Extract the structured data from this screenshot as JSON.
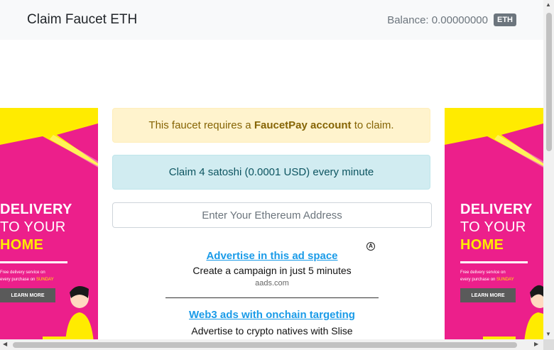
{
  "navbar": {
    "brand": "Claim Faucet ETH",
    "balance_label": "Balance: 0.00000000",
    "currency_badge": "ETH"
  },
  "alerts": {
    "faucetpay_prefix": "This faucet requires a",
    "faucetpay_strong": "FaucetPay account",
    "faucetpay_suffix": "to claim.",
    "claim_info": "Claim 4 satoshi (0.0001 USD) every minute"
  },
  "address_input": {
    "placeholder": "Enter Your Ethereum Address",
    "value": ""
  },
  "side_ads": {
    "line1": "DELIVERY",
    "line2": "TO YOUR",
    "line3": "HOME",
    "small1": "Free delivery service on",
    "small2_prefix": "every purchase on",
    "small2_day": "SUNDAY",
    "button": "LEARN MORE"
  },
  "aads": {
    "icon": "aads-logo-icon",
    "ad1_link": "Advertise in this ad space",
    "ad1_desc": "Create a campaign in just 5 minutes",
    "ad1_domain": "aads.com",
    "ad2_link": "Web3 ads with onchain targeting",
    "ad2_desc": "Advertise to crypto natives with Slise"
  },
  "colors": {
    "ad_pink": "#ec1f8b",
    "ad_yellow": "#ffeb00",
    "link_blue": "#1a9be8"
  }
}
